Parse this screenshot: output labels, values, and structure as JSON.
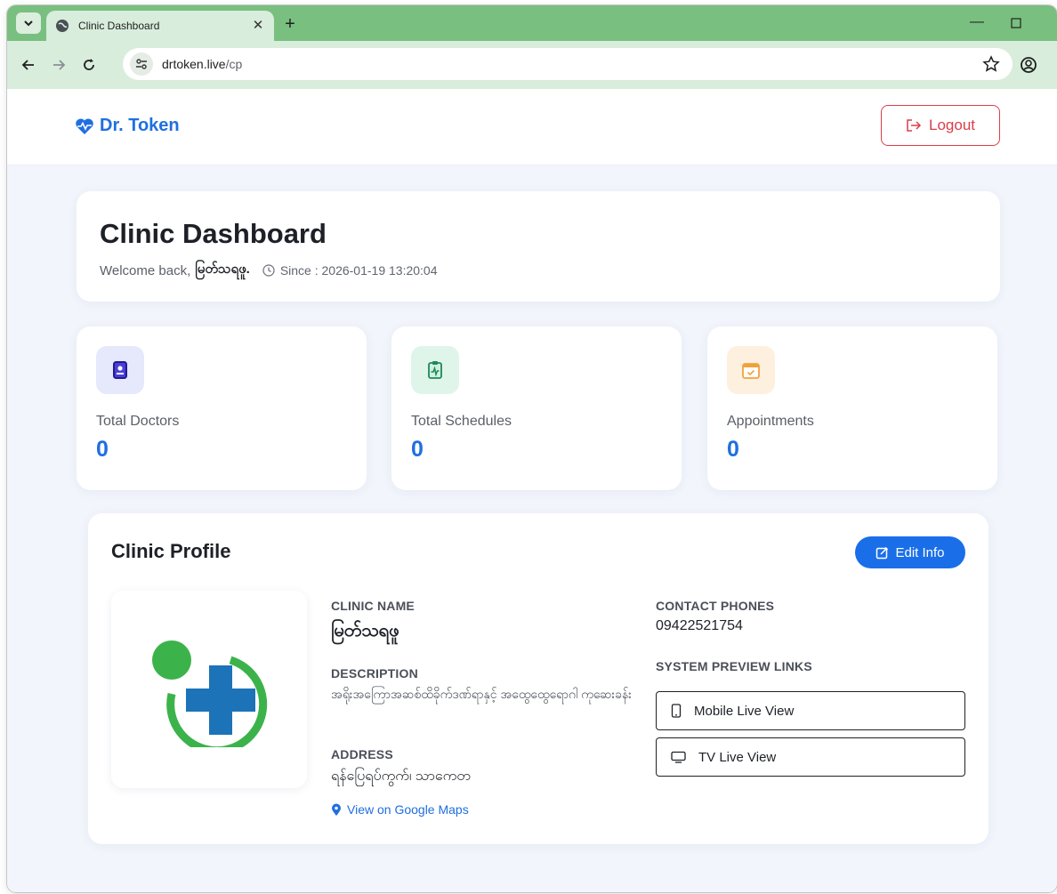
{
  "browser": {
    "tab_title": "Clinic Dashboard",
    "new_tab": "+",
    "url_host": "drtoken.live",
    "url_path": "/cp"
  },
  "header": {
    "brand": "Dr. Token",
    "logout_label": "Logout"
  },
  "welcome": {
    "title": "Clinic Dashboard",
    "greeting": "Welcome back,",
    "user": "မြတ်သရဖူ.",
    "since": "Since : 2026-01-19 13:20:04"
  },
  "stats": [
    {
      "label": "Total Doctors",
      "value": "0",
      "icon": "doctor-badge-icon",
      "icon_bg": "#e6e8fb",
      "icon_color": "#4b3fd6"
    },
    {
      "label": "Total Schedules",
      "value": "0",
      "icon": "clipboard-pulse-icon",
      "icon_bg": "#dff5ea",
      "icon_color": "#22a86b"
    },
    {
      "label": "Appointments",
      "value": "0",
      "icon": "calendar-check-icon",
      "icon_bg": "#fdf0df",
      "icon_color": "#f0a23a"
    }
  ],
  "profile": {
    "title": "Clinic Profile",
    "edit_label": "Edit Info",
    "clinic_name_label": "CLINIC NAME",
    "clinic_name": "မြတ်သရဖူ",
    "description_label": "DESCRIPTION",
    "description": "အရိုးအကြောအဆစ်ထိခိုက်ဒဏ်ရာနှင့် အထွေထွေရောဂါ ကုဆေးခန်း",
    "address_label": "ADDRESS",
    "address": "ရန်ပြေရပ်ကွက်၊ သာကေတ",
    "maps_link": "View on Google Maps",
    "contact_label": "CONTACT PHONES",
    "phone": "09422521754",
    "preview_label": "SYSTEM PREVIEW LINKS",
    "mobile_view": "Mobile Live View",
    "tv_view": "TV Live View"
  },
  "colors": {
    "brand_blue": "#1f6fe0",
    "logout_red": "#dc3d4a",
    "chrome_green": "#79bf7f"
  }
}
